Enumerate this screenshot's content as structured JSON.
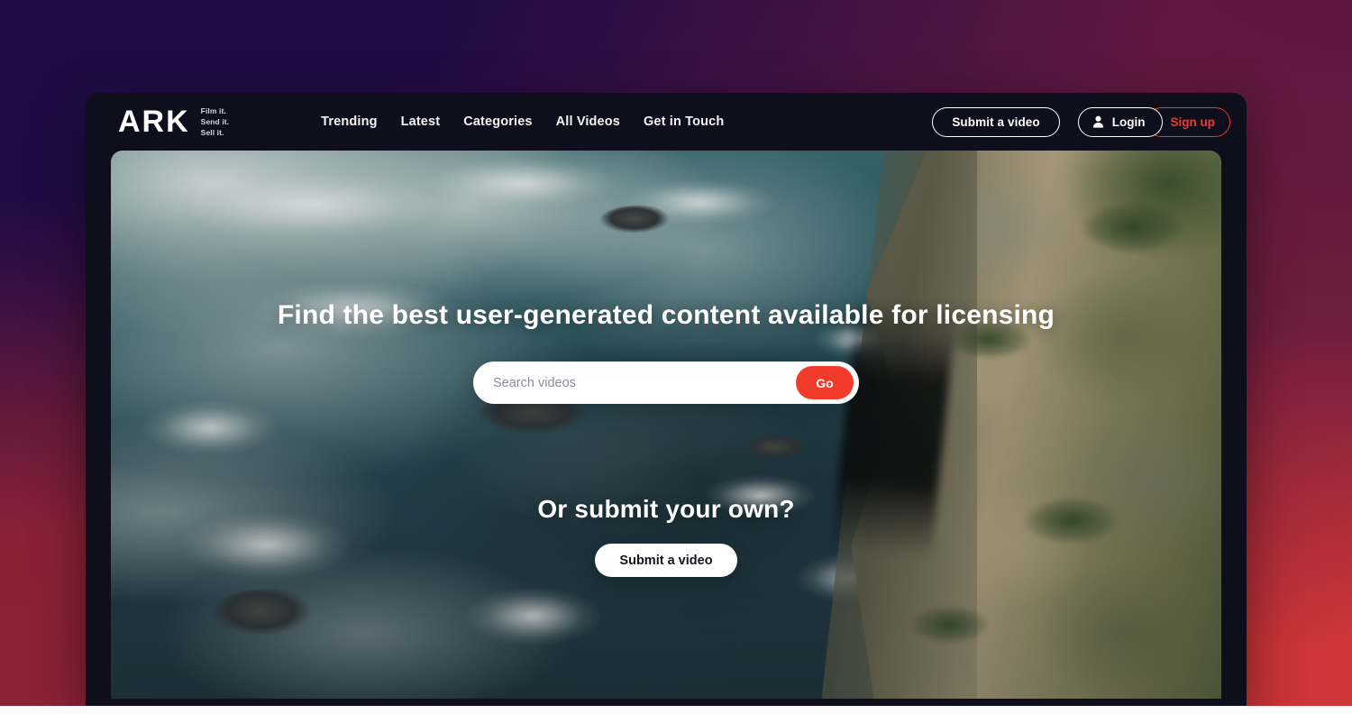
{
  "theme": {
    "backdrop_top_left": "#200b46",
    "backdrop_top_right": "#5d1840",
    "backdrop_bottom_left": "#8c2236",
    "backdrop_bottom_right": "#dc3a37",
    "window_bg": "#0e0e1c",
    "accent_red": "#f23b2a",
    "signup_red": "#ef3a2c"
  },
  "navbar": {
    "brand": {
      "mark": "ARK",
      "tagline_lines": [
        "Film it.",
        "Send it.",
        "Sell it."
      ]
    },
    "links": [
      {
        "label": "Trending"
      },
      {
        "label": "Latest"
      },
      {
        "label": "Categories"
      },
      {
        "label": "All Videos"
      },
      {
        "label": "Get in Touch"
      }
    ],
    "submit_video_label": "Submit a video",
    "login_label": "Login",
    "signup_label": "Sign up",
    "login_icon": "person-icon"
  },
  "hero": {
    "headline": "Find the best user-generated content available for licensing",
    "search": {
      "value": "",
      "placeholder": "Search videos",
      "go_label": "Go"
    },
    "submit_title": "Or submit your own?",
    "submit_cta_label": "Submit a video",
    "background_description": "Aerial photo of teal ocean surf meeting a rocky coastal cliff"
  }
}
